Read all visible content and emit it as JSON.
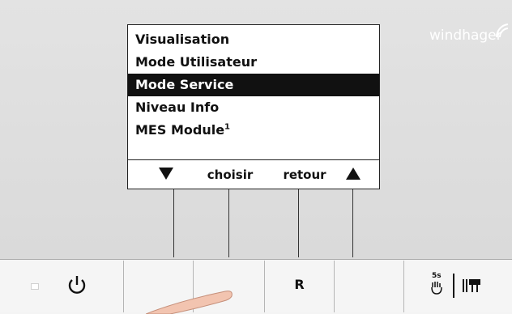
{
  "brand": "windhager",
  "menu": {
    "items": [
      {
        "label": "Visualisation",
        "sup": ""
      },
      {
        "label": "Mode Utilisateur",
        "sup": ""
      },
      {
        "label": "Mode Service",
        "sup": ""
      },
      {
        "label": "Niveau Info",
        "sup": ""
      },
      {
        "label": "MES Module",
        "sup": "1"
      }
    ],
    "selected_index": 2
  },
  "softkeys": {
    "down_icon": "triangle-down-icon",
    "choose_label": "choisir",
    "back_label": "retour",
    "up_icon": "triangle-up-icon"
  },
  "buttons": {
    "power_icon": "power-icon",
    "reset_label": "R",
    "hand_timer_label": "5s",
    "hand_icon": "hand-icon",
    "heating_icon": "heating-pump-icon"
  },
  "colors": {
    "panel": "#dcdcdc",
    "screen_bg": "#ffffff",
    "selection_bg": "#111111",
    "button_bg": "#f5f5f5"
  }
}
